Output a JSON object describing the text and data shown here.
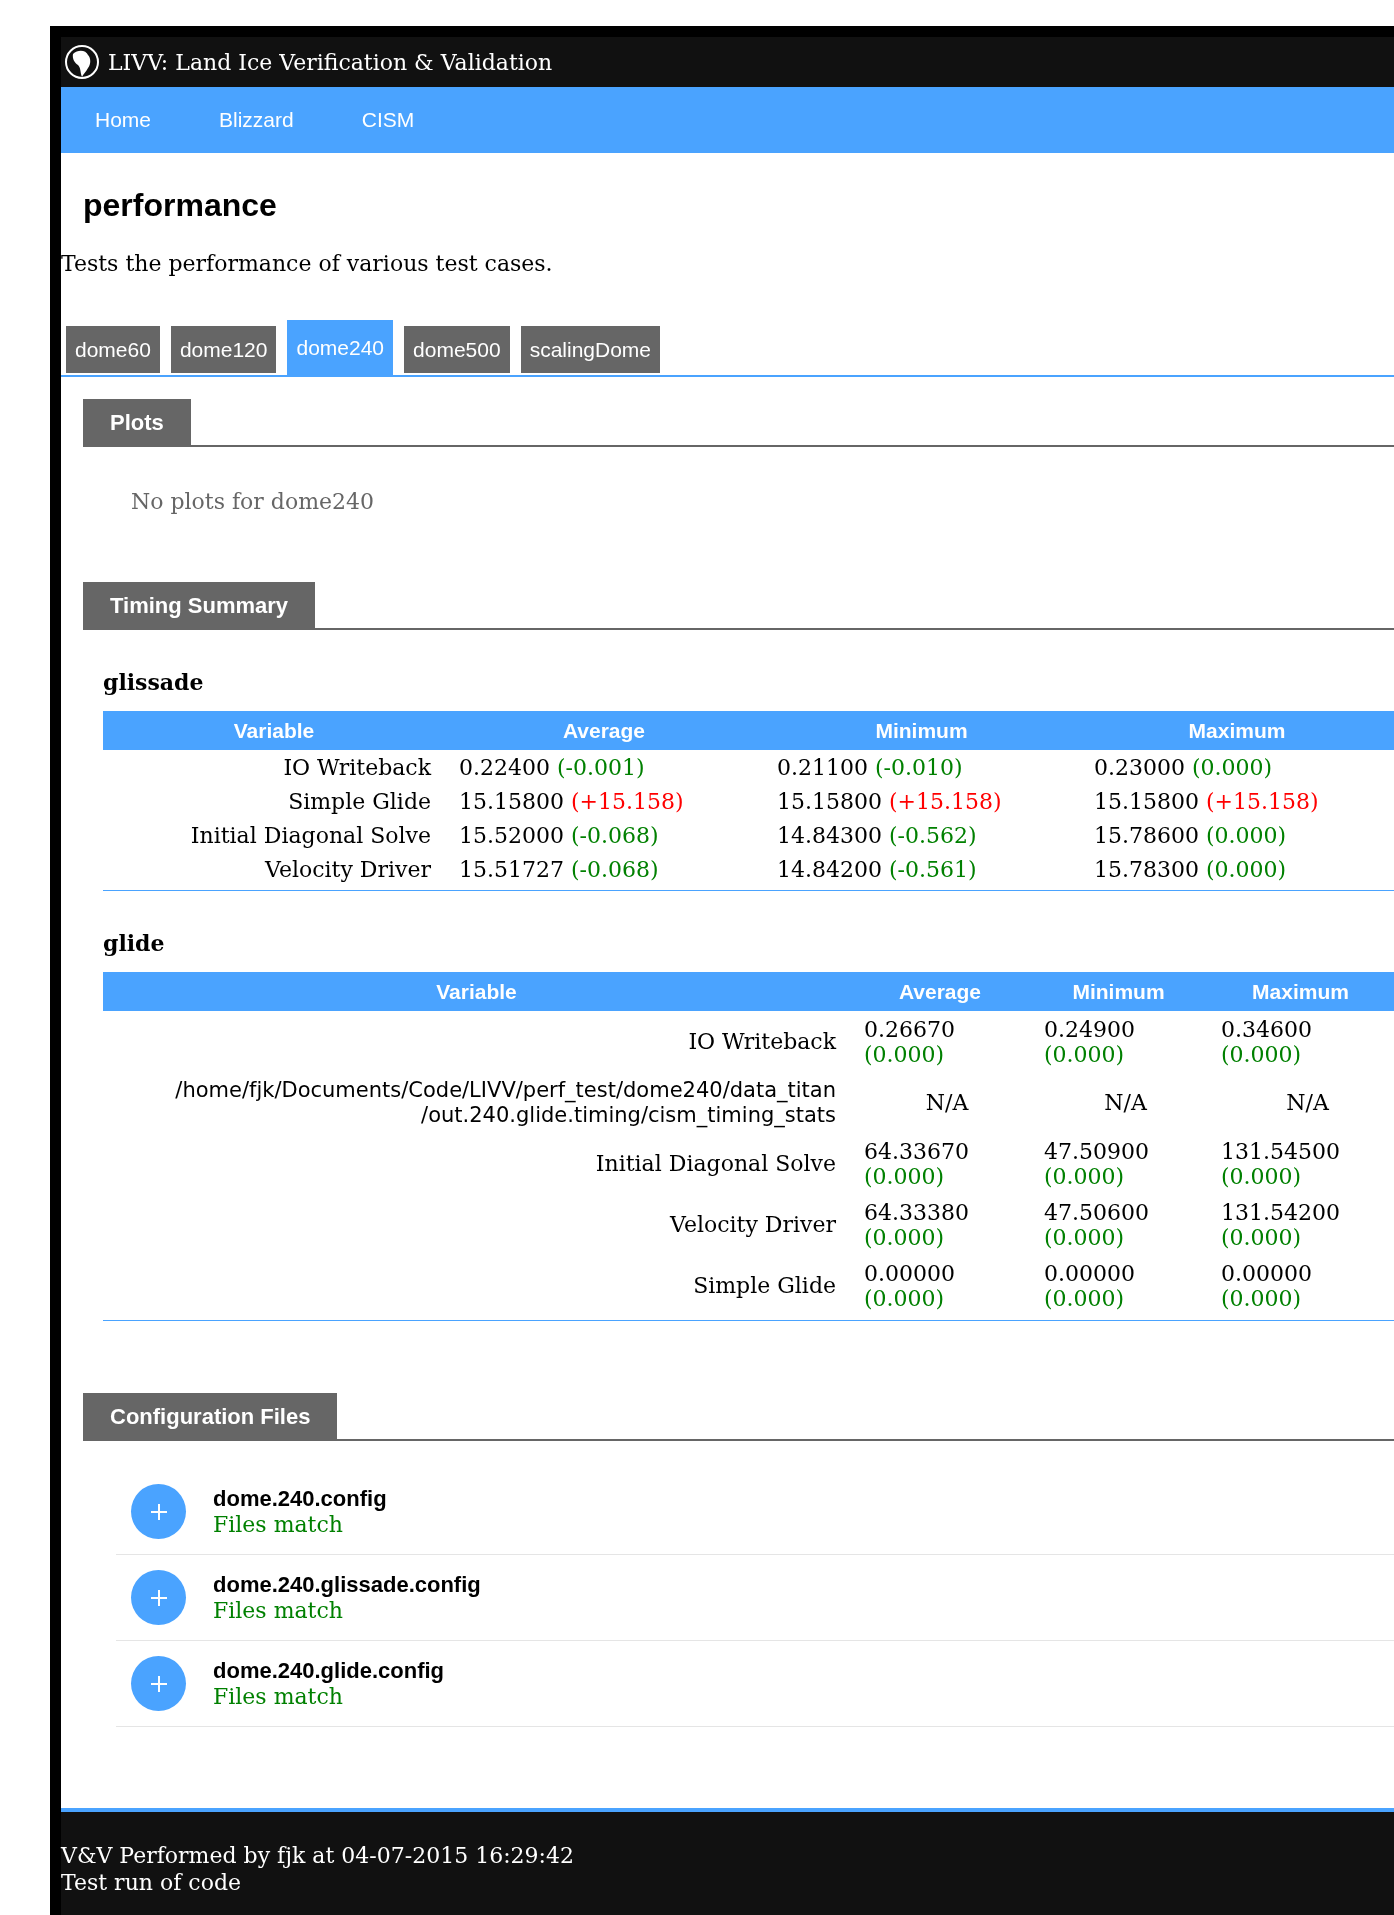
{
  "header": {
    "title": "LIVV: Land Ice Verification & Validation"
  },
  "nav": [
    "Home",
    "Blizzard",
    "CISM"
  ],
  "page": {
    "title": "performance",
    "description": "Tests the performance of various test cases."
  },
  "tabs": [
    {
      "label": "dome60",
      "selected": false
    },
    {
      "label": "dome120",
      "selected": false
    },
    {
      "label": "dome240",
      "selected": true
    },
    {
      "label": "dome500",
      "selected": false
    },
    {
      "label": "scalingDome",
      "selected": false
    }
  ],
  "plots": {
    "heading": "Plots",
    "message": "No plots for dome240"
  },
  "timing": {
    "heading": "Timing Summary",
    "tables": [
      {
        "title": "glissade",
        "kind": "wide",
        "columns": [
          "Variable",
          "Average",
          "Minimum",
          "Maximum"
        ],
        "rows": [
          {
            "cells": [
              {
                "value": "IO Writeback"
              },
              {
                "value": "0.22400",
                "delta": "(-0.001)",
                "color": "#008000"
              },
              {
                "value": "0.21100",
                "delta": "(-0.010)",
                "color": "#008000"
              },
              {
                "value": "0.23000",
                "delta": "(0.000)",
                "color": "#008000"
              }
            ]
          },
          {
            "cells": [
              {
                "value": "Simple Glide"
              },
              {
                "value": "15.15800",
                "delta": "(+15.158)",
                "color": "#ff0000"
              },
              {
                "value": "15.15800",
                "delta": "(+15.158)",
                "color": "#ff0000"
              },
              {
                "value": "15.15800",
                "delta": "(+15.158)",
                "color": "#ff0000"
              }
            ]
          },
          {
            "cells": [
              {
                "value": "Initial Diagonal Solve"
              },
              {
                "value": "15.52000",
                "delta": "(-0.068)",
                "color": "#008000"
              },
              {
                "value": "14.84300",
                "delta": "(-0.562)",
                "color": "#008000"
              },
              {
                "value": "15.78600",
                "delta": "(0.000)",
                "color": "#008000"
              }
            ]
          },
          {
            "cells": [
              {
                "value": "Velocity Driver"
              },
              {
                "value": "15.51727",
                "delta": "(-0.068)",
                "color": "#008000"
              },
              {
                "value": "14.84200",
                "delta": "(-0.561)",
                "color": "#008000"
              },
              {
                "value": "15.78300",
                "delta": "(0.000)",
                "color": "#008000"
              }
            ]
          }
        ]
      },
      {
        "title": "glide",
        "kind": "stacked",
        "columns": [
          "Variable",
          "Average",
          "Minimum",
          "Maximum"
        ],
        "rows": [
          {
            "cells": [
              {
                "value": "IO Writeback"
              },
              {
                "value": "0.26670",
                "delta": "(0.000)",
                "color": "#008000"
              },
              {
                "value": "0.24900",
                "delta": "(0.000)",
                "color": "#008000"
              },
              {
                "value": "0.34600",
                "delta": "(0.000)",
                "color": "#008000"
              }
            ]
          },
          {
            "cells": [
              {
                "value": "/home/fjk/Documents/Code/LIVV/perf_test/dome240/data_titan /out.240.glide.timing/cism_timing_stats",
                "kind": "path"
              },
              {
                "value": "N/A"
              },
              {
                "value": "N/A"
              },
              {
                "value": "N/A"
              }
            ]
          },
          {
            "cells": [
              {
                "value": "Initial Diagonal Solve"
              },
              {
                "value": "64.33670",
                "delta": "(0.000)",
                "color": "#008000"
              },
              {
                "value": "47.50900",
                "delta": "(0.000)",
                "color": "#008000"
              },
              {
                "value": "131.54500",
                "delta": "(0.000)",
                "color": "#008000"
              }
            ]
          },
          {
            "cells": [
              {
                "value": "Velocity Driver"
              },
              {
                "value": "64.33380",
                "delta": "(0.000)",
                "color": "#008000"
              },
              {
                "value": "47.50600",
                "delta": "(0.000)",
                "color": "#008000"
              },
              {
                "value": "131.54200",
                "delta": "(0.000)",
                "color": "#008000"
              }
            ]
          },
          {
            "cells": [
              {
                "value": "Simple Glide"
              },
              {
                "value": "0.00000",
                "delta": "(0.000)",
                "color": "#008000"
              },
              {
                "value": "0.00000",
                "delta": "(0.000)",
                "color": "#008000"
              },
              {
                "value": "0.00000",
                "delta": "(0.000)",
                "color": "#008000"
              }
            ]
          }
        ]
      }
    ]
  },
  "config": {
    "heading": "Configuration Files",
    "files": [
      {
        "name": "dome.240.config",
        "status": "Files match",
        "color": "#008000"
      },
      {
        "name": "dome.240.glissade.config",
        "status": "Files match",
        "color": "#008000"
      },
      {
        "name": "dome.240.glide.config",
        "status": "Files match",
        "color": "#008000"
      }
    ]
  },
  "footer": {
    "lines": [
      "V&V Performed by fjk at 04-07-2015 16:29:42",
      "Test run of code"
    ]
  }
}
